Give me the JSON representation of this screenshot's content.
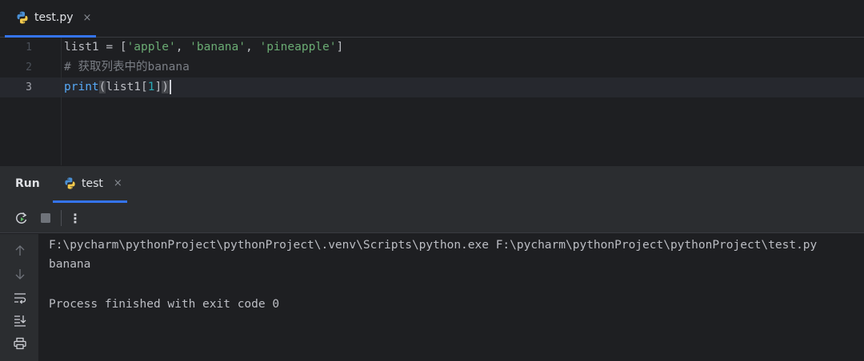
{
  "editor": {
    "tab": {
      "label": "test.py",
      "close": "×"
    },
    "line_numbers": [
      "1",
      "2",
      "3"
    ],
    "code": {
      "line1": {
        "a": "list1 = [",
        "s1": "'apple'",
        "c1": ", ",
        "s2": "'banana'",
        "c2": ", ",
        "s3": "'pineapple'",
        "end": "]"
      },
      "line2": {
        "comment": "# 获取列表中的banana"
      },
      "line3": {
        "kw": "print",
        "p_open": "(",
        "mid": "list1[",
        "num": "1",
        "close_br": "]",
        "p_close": ")"
      }
    }
  },
  "run_panel": {
    "title": "Run",
    "tab": {
      "label": "test",
      "close": "×"
    },
    "toolbar": {
      "more": "⋮"
    },
    "output": [
      "F:\\pycharm\\pythonProject\\pythonProject\\.venv\\Scripts\\python.exe F:\\pycharm\\pythonProject\\pythonProject\\test.py",
      "banana",
      "",
      "Process finished with exit code 0"
    ]
  },
  "colors": {
    "accent": "#3574f0",
    "string": "#6aab73",
    "keyword": "#56a8f5",
    "number": "#2aacb8",
    "comment": "#7a7e85"
  }
}
